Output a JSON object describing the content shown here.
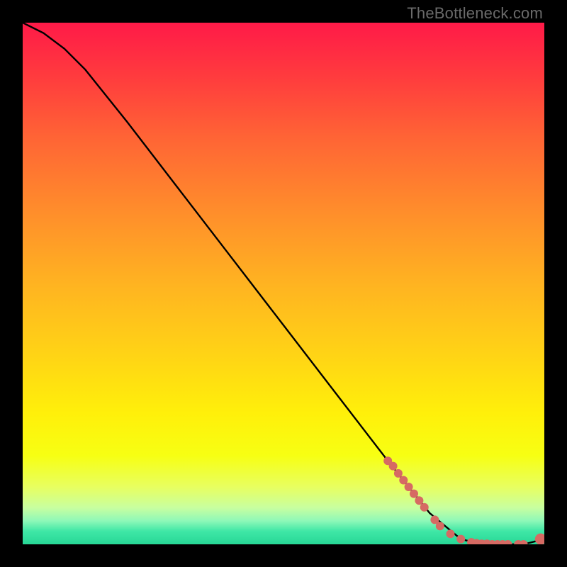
{
  "watermark": "TheBottleneck.com",
  "gradient": {
    "stops": [
      {
        "offset": 0.0,
        "color": "#ff1a48"
      },
      {
        "offset": 0.1,
        "color": "#ff3a3e"
      },
      {
        "offset": 0.22,
        "color": "#ff6435"
      },
      {
        "offset": 0.35,
        "color": "#ff8a2c"
      },
      {
        "offset": 0.5,
        "color": "#ffb321"
      },
      {
        "offset": 0.63,
        "color": "#ffd216"
      },
      {
        "offset": 0.75,
        "color": "#fff00a"
      },
      {
        "offset": 0.83,
        "color": "#f7ff13"
      },
      {
        "offset": 0.89,
        "color": "#e8ff60"
      },
      {
        "offset": 0.93,
        "color": "#c8ffa0"
      },
      {
        "offset": 0.955,
        "color": "#8ef8b8"
      },
      {
        "offset": 0.975,
        "color": "#3fe7a6"
      },
      {
        "offset": 1.0,
        "color": "#27d796"
      }
    ]
  },
  "chart_data": {
    "type": "line",
    "title": "",
    "xlabel": "",
    "ylabel": "",
    "xlim": [
      0,
      100
    ],
    "ylim": [
      0,
      100
    ],
    "series": [
      {
        "name": "bottleneck-curve",
        "x": [
          0,
          4,
          8,
          12,
          20,
          30,
          40,
          50,
          60,
          70,
          78,
          84,
          88,
          92,
          96,
          100
        ],
        "y": [
          100,
          98,
          95,
          91,
          81,
          68,
          55,
          42,
          29,
          16,
          6,
          1,
          0,
          0,
          0,
          1
        ]
      }
    ],
    "markers": {
      "name": "highlight-points",
      "color": "#d66a63",
      "x": [
        70,
        71,
        72,
        73,
        74,
        75,
        76,
        77,
        79,
        80,
        82,
        84,
        86,
        87,
        88,
        89,
        90,
        91,
        92,
        93,
        95,
        96,
        99.3
      ],
      "y": [
        16,
        15,
        13.6,
        12.3,
        11,
        9.7,
        8.4,
        7.1,
        4.7,
        3.5,
        2.0,
        1.0,
        0.4,
        0.2,
        0.1,
        0.1,
        0.0,
        0.0,
        0.0,
        0.0,
        0.0,
        0.0,
        1.0
      ],
      "r": [
        6,
        6,
        6,
        6,
        6,
        6,
        6,
        6,
        6,
        6,
        6,
        6,
        6,
        6,
        6,
        6,
        6,
        6,
        6,
        6,
        6,
        6,
        8
      ]
    }
  }
}
